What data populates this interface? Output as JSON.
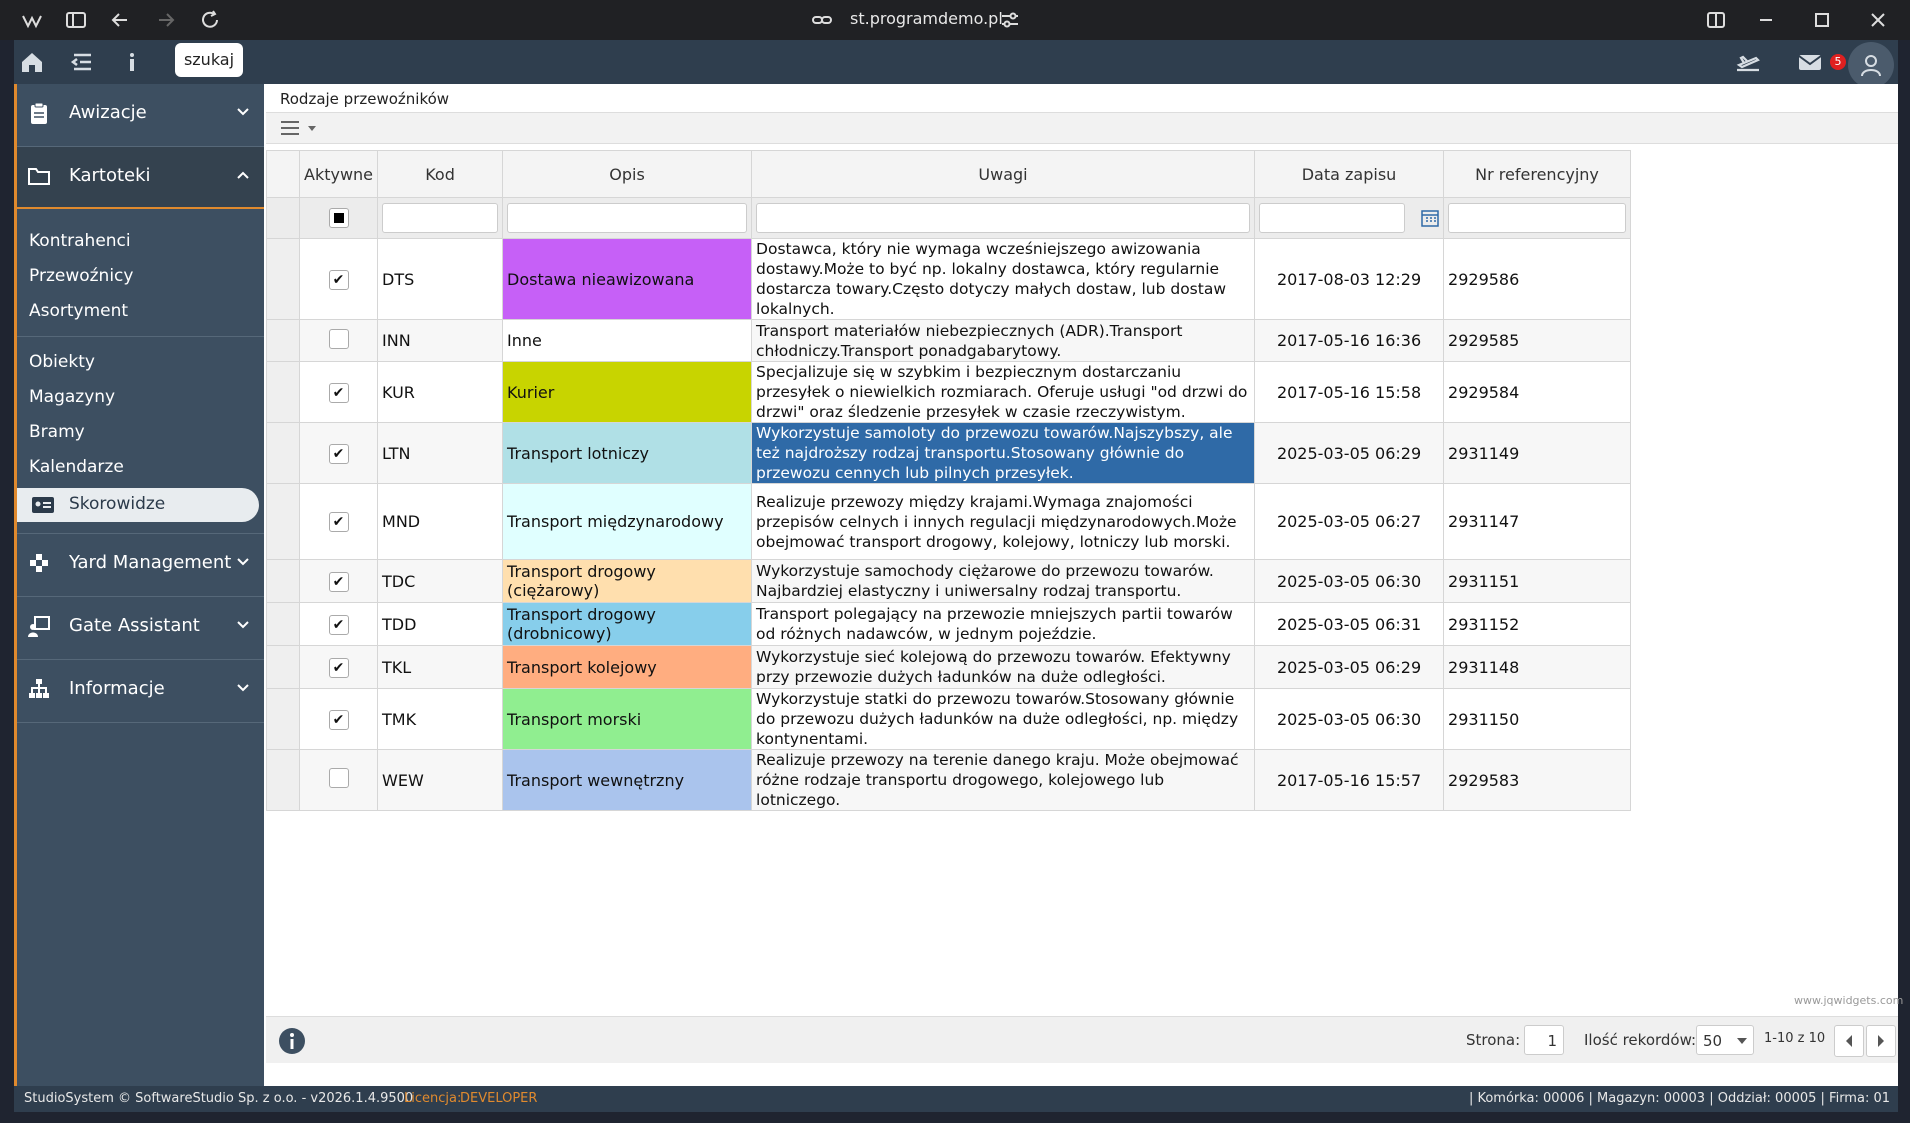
{
  "browser": {
    "url": "st.programdemo.pl"
  },
  "topbar": {
    "search_label": "szukaj",
    "mail_badge": "5"
  },
  "sidebar": {
    "sections": [
      {
        "label": "Awizacje"
      },
      {
        "label": "Kartoteki"
      },
      {
        "label": "Yard Management"
      },
      {
        "label": "Gate Assistant"
      },
      {
        "label": "Informacje"
      }
    ],
    "kartoteki_items_1": [
      "Kontrahenci",
      "Przewoźnicy",
      "Asortyment"
    ],
    "kartoteki_items_2": [
      "Obiekty",
      "Magazyny",
      "Bramy",
      "Kalendarze"
    ],
    "active_item": "Skorowidze"
  },
  "page": {
    "title": "Rodzaje przewoźników"
  },
  "grid": {
    "columns": [
      "Aktywne",
      "Kod",
      "Opis",
      "Uwagi",
      "Data zapisu",
      "Nr referencyjny"
    ],
    "rows": [
      {
        "active": true,
        "kod": "DTS",
        "opis": "Dostawa nieawizowana",
        "color": "#c660f7",
        "uwagi": "Dostawca, który nie wymaga wcześniejszego awizowania dostawy.Może to być np. lokalny dostawca, który regularnie dostarcza towary.Często dotyczy małych dostaw, lub dostaw lokalnych.",
        "data": "2017-08-03 12:29",
        "nr": "2929586"
      },
      {
        "active": false,
        "kod": "INN",
        "opis": "Inne",
        "color": "#ffffff",
        "uwagi": "Transport materiałów niebezpiecznych (ADR).Transport chłodniczy.Transport ponadgabarytowy.",
        "data": "2017-05-16 16:36",
        "nr": "2929585"
      },
      {
        "active": true,
        "kod": "KUR",
        "opis": "Kurier",
        "color": "#c8d400",
        "uwagi": "Specjalizuje się w szybkim i bezpiecznym dostarczaniu przesyłek o niewielkich rozmiarach. Oferuje usługi \"od drzwi do drzwi\" oraz śledzenie przesyłek w czasie rzeczywistym.",
        "data": "2017-05-16 15:58",
        "nr": "2929584"
      },
      {
        "active": true,
        "kod": "LTN",
        "opis": "Transport lotniczy",
        "color": "#b0e0e6",
        "uwagi": "Wykorzystuje samoloty do przewozu towarów.Najszybszy, ale też najdroższy rodzaj transportu.Stosowany głównie do przewozu cennych lub pilnych przesyłek.",
        "data": "2025-03-05 06:29",
        "nr": "2931149",
        "selected": true
      },
      {
        "active": true,
        "kod": "MND",
        "opis": "Transport międzynarodowy",
        "color": "#e0ffff",
        "uwagi": "Realizuje przewozy między krajami.Wymaga znajomości przepisów celnych i innych regulacji międzynarodowych.Może obejmować transport drogowy, kolejowy, lotniczy lub morski.",
        "data": "2025-03-05 06:27",
        "nr": "2931147"
      },
      {
        "active": true,
        "kod": "TDC",
        "opis": "Transport drogowy (ciężarowy)",
        "color": "#ffdfae",
        "uwagi": "Wykorzystuje samochody ciężarowe do przewozu towarów. Najbardziej elastyczny i uniwersalny rodzaj transportu.",
        "data": "2025-03-05 06:30",
        "nr": "2931151"
      },
      {
        "active": true,
        "kod": "TDD",
        "opis": "Transport drogowy (drobnicowy)",
        "color": "#87ceeb",
        "uwagi": "Transport polegający na przewozie mniejszych partii towarów od różnych nadawców, w jednym pojeździe.",
        "data": "2025-03-05 06:31",
        "nr": "2931152"
      },
      {
        "active": true,
        "kod": "TKL",
        "opis": "Transport kolejowy",
        "color": "#ffad80",
        "uwagi": "Wykorzystuje sieć kolejową do przewozu towarów. Efektywny przy przewozie dużych ładunków na duże odległości.",
        "data": "2025-03-05 06:29",
        "nr": "2931148"
      },
      {
        "active": true,
        "kod": "TMK",
        "opis": "Transport morski",
        "color": "#90ee90",
        "uwagi": "Wykorzystuje statki do przewozu towarów.Stosowany głównie do przewozu dużych ładunków na duże odległości, np. między kontynentami.",
        "data": "2025-03-05 06:30",
        "nr": "2931150"
      },
      {
        "active": false,
        "kod": "WEW",
        "opis": "Transport wewnętrzny",
        "color": "#aac4ed",
        "uwagi": "Realizuje przewozy na terenie danego kraju. Może obejmować różne rodzaje transportu drogowego, kolejowego lub lotniczego.",
        "data": "2017-05-16 15:57",
        "nr": "2929583"
      }
    ]
  },
  "footer": {
    "watermark": "www.jqwidgets.com",
    "page_label": "Strona:",
    "page_value": "1",
    "records_label": "Ilość rekordów:",
    "records_value": "50",
    "range": "1-10 z 10"
  },
  "status": {
    "copyright": "StudioSystem © SoftwareStudio Sp. z o.o. - v2026.1.4.9500",
    "license_label": "Licencja:",
    "license_value": "DEVELOPER",
    "right": "| Komórka: 00006 | Magazyn: 00003 | Oddział: 00005 | Firma: 01"
  },
  "colors": {
    "accent": "#e08a2e",
    "sidebar": "#3d4f61",
    "topbar": "#2f3e4e",
    "selection": "#2f6aa7"
  }
}
